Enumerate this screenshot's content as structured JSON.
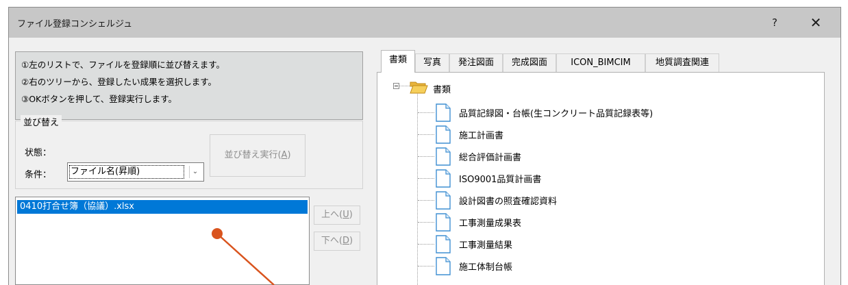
{
  "window": {
    "title": "ファイル登録コンシェルジュ",
    "help_label": "?",
    "close_label": "✕"
  },
  "instructions": [
    "①左のリストで、ファイルを登録順に並び替えます。",
    "②右のツリーから、登録したい成果を選択します。",
    "③OKボタンを押して、登録実行します。"
  ],
  "sort": {
    "group_title": "並び替え",
    "state_label": "状態：",
    "condition_label": "条件：",
    "condition_value": "ファイル名(昇順)",
    "execute_label": "並び替え実行(",
    "execute_accel": "A",
    "execute_suffix": ")"
  },
  "files": [
    "0410打合せ簿（協議）.xlsx"
  ],
  "move": {
    "up_label": "上へ(",
    "up_accel": "U",
    "down_label": "下へ(",
    "down_accel": "D",
    "suffix": ")"
  },
  "tabs": [
    "書類",
    "写真",
    "発注図面",
    "完成図面",
    "ICON_BIMCIM",
    "地質調査関連"
  ],
  "active_tab": "書類",
  "tree": {
    "root": "書類",
    "items": [
      "品質記録図・台帳(生コンクリート品質記録表等)",
      "施工計画書",
      "総合評価計画書",
      "ISO9001品質計画書",
      "設計図書の照査確認資料",
      "工事測量成果表",
      "工事測量結果",
      "施工体制台帳"
    ]
  },
  "icons": {
    "folder": "folder-open-icon",
    "document": "document-icon",
    "chevron": "chevron-down-icon"
  },
  "colors": {
    "selection": "#0078d7",
    "annotation": "#d9541e",
    "titlebar": "#c7c7c7"
  }
}
